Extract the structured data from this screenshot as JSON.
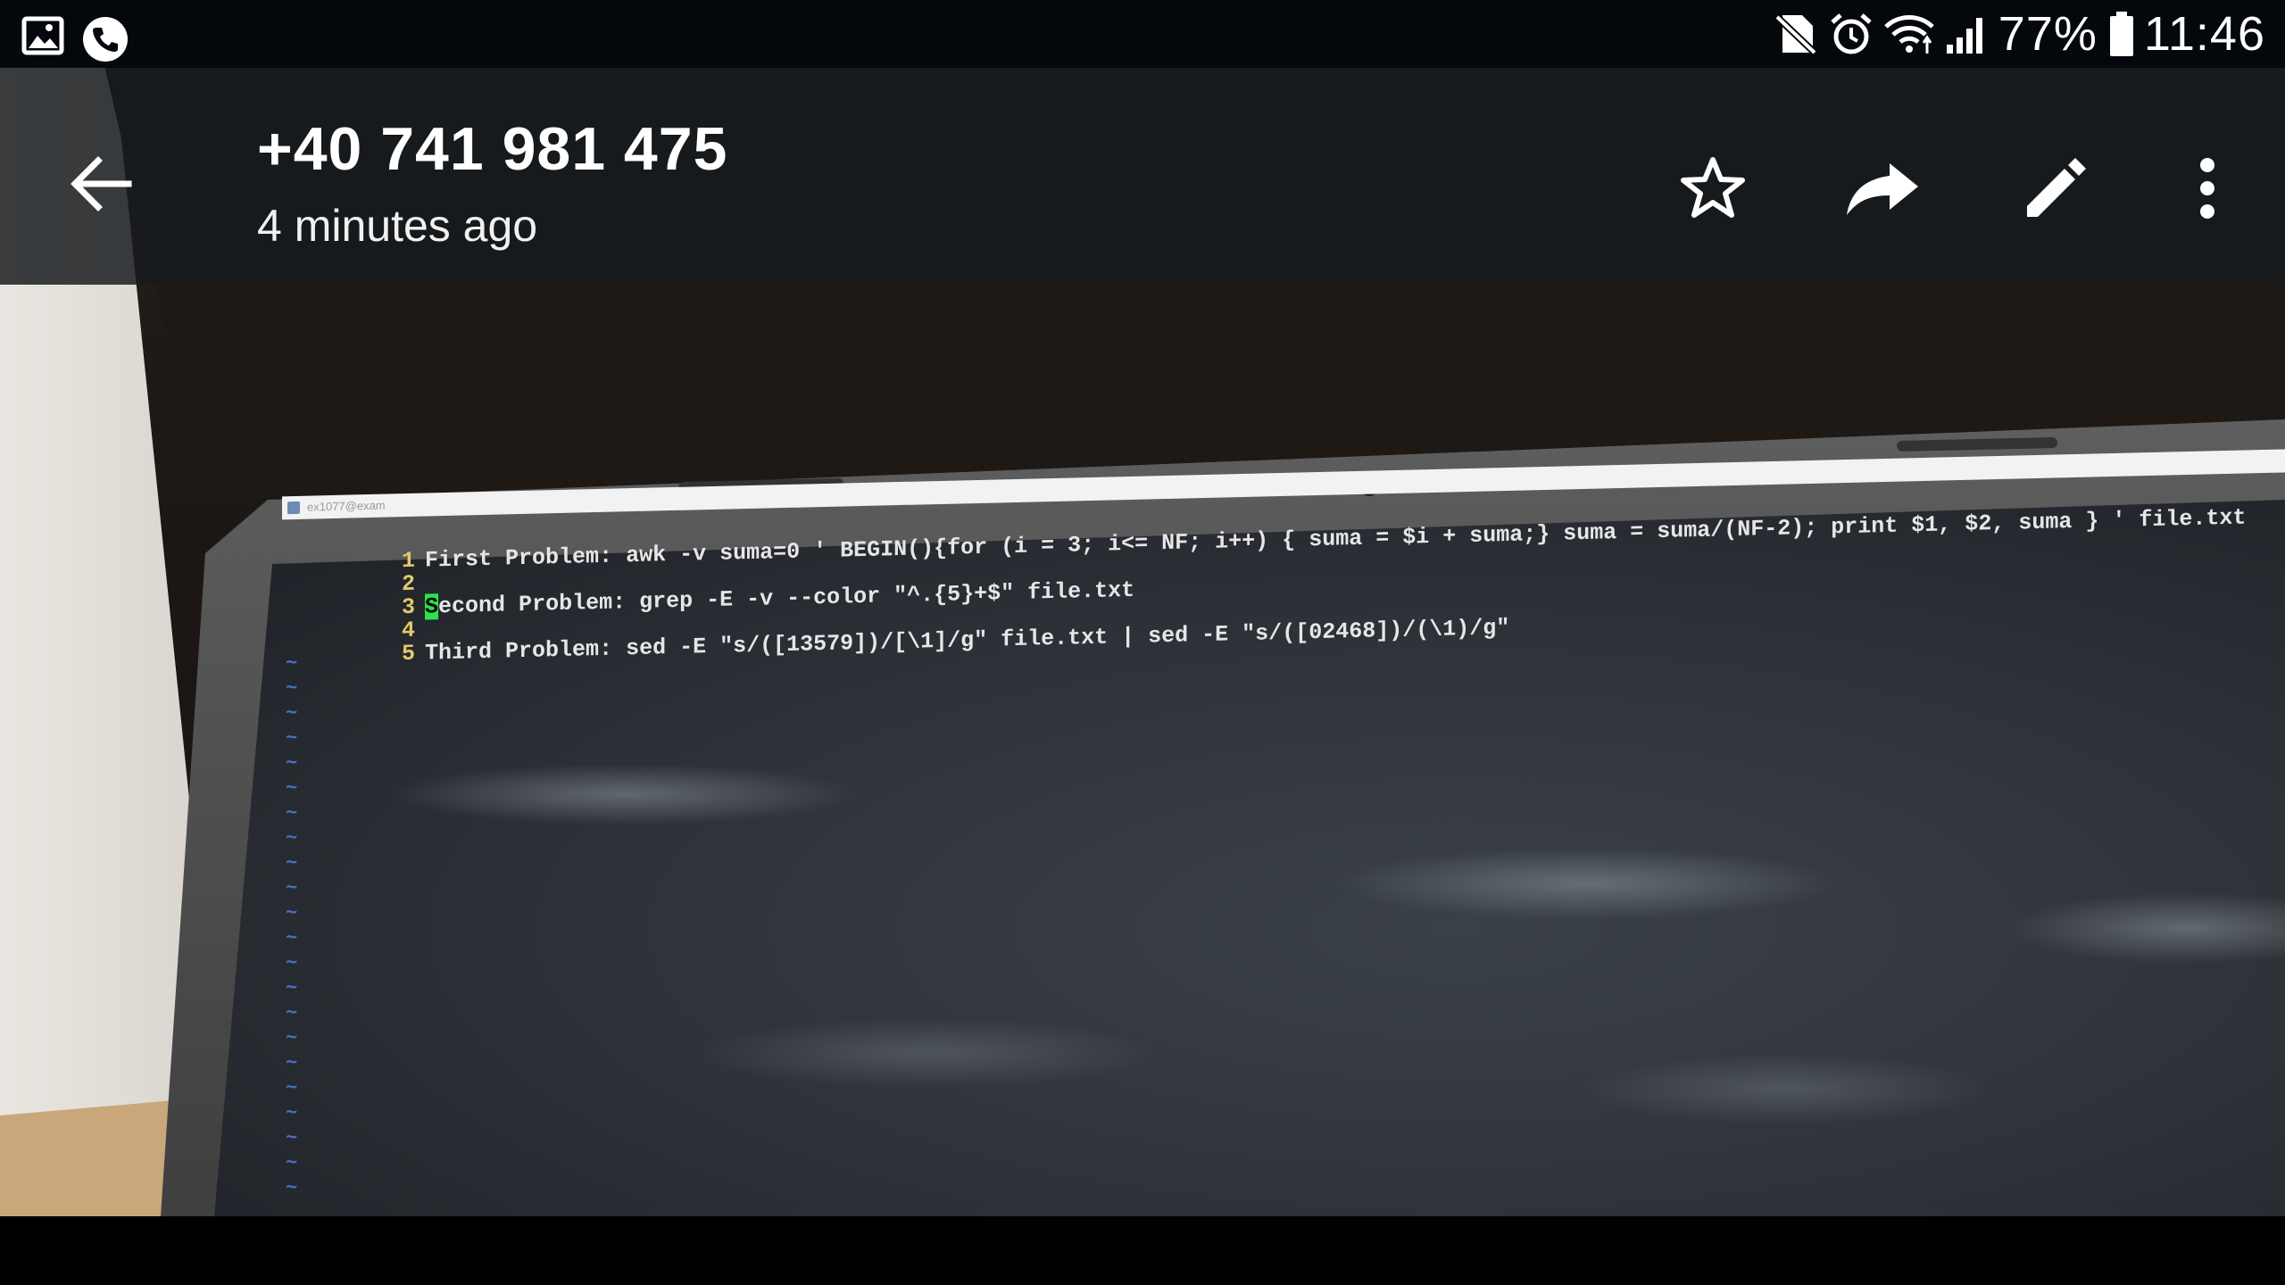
{
  "status_bar": {
    "battery_percent": "77%",
    "time": "11:46",
    "left_icons": [
      "gallery-icon",
      "phone-call-icon"
    ],
    "right_icons": [
      "no-sim-icon",
      "alarm-icon",
      "wifi-icon",
      "signal-icon",
      "battery-icon"
    ]
  },
  "header": {
    "title": "+40 741 981 475",
    "subtitle": "4 minutes ago",
    "actions": [
      "back-arrow-icon",
      "star-icon",
      "share-icon",
      "edit-icon",
      "more-vert-icon"
    ]
  },
  "photo": {
    "terminal": {
      "title_text": "ex1077@exam",
      "lines": [
        {
          "num": "1",
          "text": "First Problem: awk -v suma=0 ' BEGIN(){for (i = 3; i<= NF; i++) { suma = $i + suma;} suma = suma/(NF-2); print $1, $2, suma } ' file.txt"
        },
        {
          "num": "2",
          "text": ""
        },
        {
          "num": "3",
          "cursor_char": "S",
          "text": "econd Problem: grep -E -v --color \"^.{5}+$\" file.txt"
        },
        {
          "num": "4",
          "text": ""
        },
        {
          "num": "5",
          "text": "Third Problem: sed -E \"s/([13579])/[\\1]/g\" file.txt | sed -E \"s/([02468])/(\\1)/g\""
        }
      ],
      "empty_line_marker": "~"
    }
  },
  "colors": {
    "status_bar_bg": "#04070b",
    "app_bar_bg": "#171a1e",
    "line_number": "#e3c96a",
    "cursor": "#2ee24a",
    "tilde": "#4c6ec8"
  }
}
